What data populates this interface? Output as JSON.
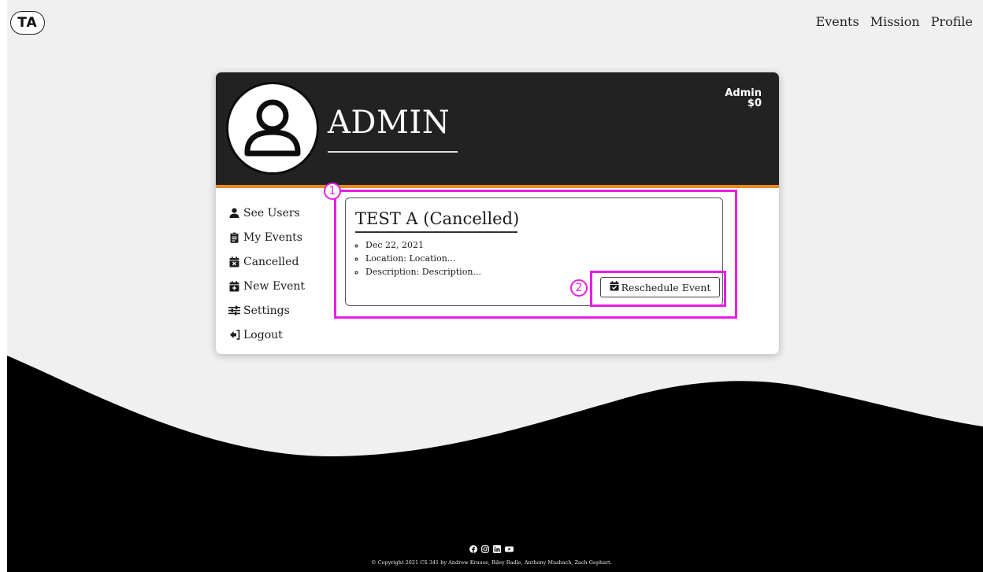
{
  "header": {
    "logo": "TA",
    "nav": [
      "Events",
      "Mission",
      "Profile"
    ]
  },
  "card": {
    "title": "ADMIN",
    "badge_line1": "Admin",
    "badge_line2": "$0"
  },
  "sidebar": {
    "items": [
      {
        "label": "See Users",
        "icon": "user-icon"
      },
      {
        "label": "My Events",
        "icon": "clipboard-icon"
      },
      {
        "label": "Cancelled",
        "icon": "calendar-x-icon"
      },
      {
        "label": "New Event",
        "icon": "calendar-plus-icon"
      },
      {
        "label": "Settings",
        "icon": "sliders-icon"
      },
      {
        "label": "Logout",
        "icon": "logout-icon"
      }
    ]
  },
  "event": {
    "title": "TEST A (Cancelled)",
    "details": [
      "Dec 22, 2021",
      "Location: Location...",
      "Description: Description..."
    ],
    "button_label": "Reschedule Event"
  },
  "annotations": [
    "1",
    "2"
  ],
  "footer": {
    "social_icons": [
      "facebook-icon",
      "instagram-icon",
      "linkedin-icon",
      "youtube-icon"
    ],
    "copyright": "© Copyright 2021 CS 341 by Andrew Krause, Riley Radle, Anthony Musbach, Zach Gephart."
  },
  "colors": {
    "header_bg": "#222222",
    "accent": "#e58a1f",
    "annotation": "#e81fe3"
  }
}
